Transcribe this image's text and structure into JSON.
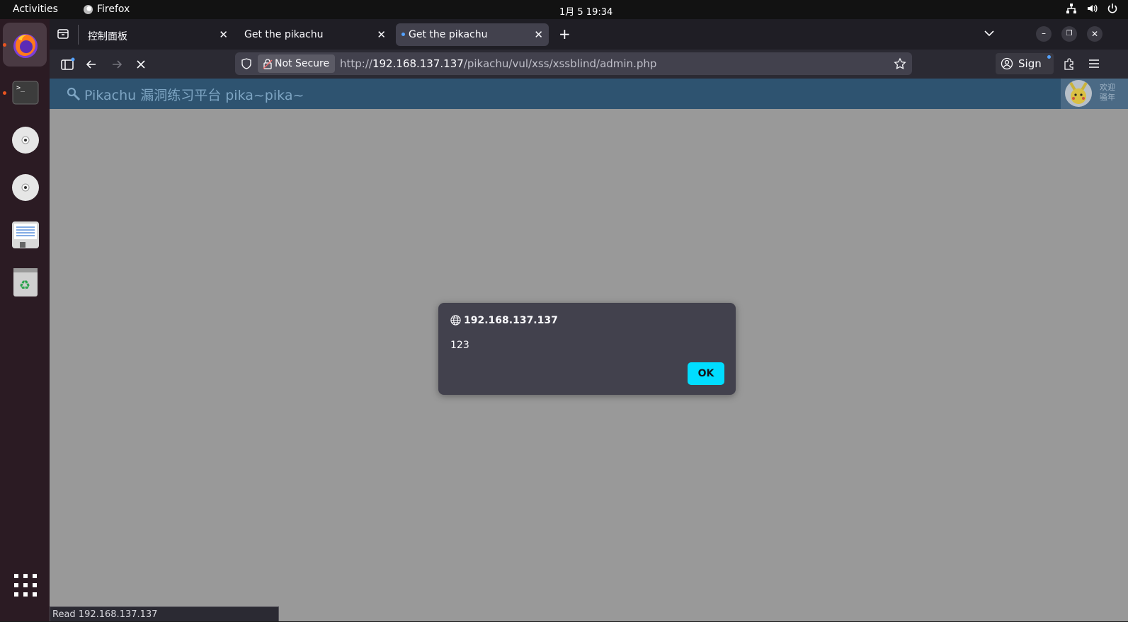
{
  "system_bar": {
    "activities": "Activities",
    "app_name": "Firefox",
    "clock": "1月 5  19:34"
  },
  "dock": {
    "items": [
      "firefox-icon",
      "terminal-icon",
      "disc-icon",
      "disc-icon",
      "floppy-icon",
      "trash-icon",
      "app-grid-icon"
    ]
  },
  "browser": {
    "tabs": [
      {
        "title": "控制面板"
      },
      {
        "title": "Get the pikachu"
      },
      {
        "title": "Get the pikachu"
      }
    ],
    "url_prefix": "http://",
    "url_host": "192.168.137.137",
    "url_path": "/pikachu/vul/xss/xssblind/admin.php",
    "not_secure_label": "Not Secure",
    "sign_in_label": "Sign in",
    "status_text": "Read 192.168.137.137"
  },
  "site": {
    "title": "Pikachu 漏洞练习平台 pika~pika~",
    "welcome_line1": "欢迎",
    "welcome_line2": "骚年"
  },
  "dialog": {
    "origin": "192.168.137.137",
    "message": "123",
    "ok_label": "OK"
  },
  "colors": {
    "accent_ok": "#00ddff",
    "site_header": "#2e5370",
    "page_overlay": "#999999",
    "dock_bg": "#2b1b23"
  }
}
